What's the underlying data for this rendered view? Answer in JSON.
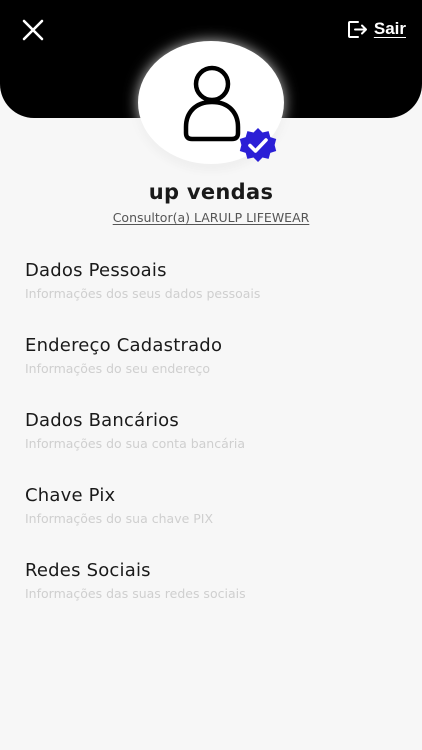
{
  "header": {
    "close_icon": "close-icon",
    "logout_icon": "logout-icon",
    "logout_label": "Sair"
  },
  "profile": {
    "avatar_icon": "person-outline-icon",
    "badge_icon": "verified-badge-icon",
    "badge_color": "#2b1fd6",
    "name": "up vendas",
    "role": "Consultor(a) LARULP LIFEWEAR"
  },
  "menu": {
    "items": [
      {
        "title": "Dados Pessoais",
        "subtitle": "Informações dos seus dados pessoais"
      },
      {
        "title": "Endereço Cadastrado",
        "subtitle": "Informações do seu endereço"
      },
      {
        "title": "Dados Bancários",
        "subtitle": "Informações do sua conta bancária"
      },
      {
        "title": "Chave Pix",
        "subtitle": "Informações do sua chave PIX"
      },
      {
        "title": "Redes Sociais",
        "subtitle": "Informações das suas redes sociais"
      }
    ]
  }
}
